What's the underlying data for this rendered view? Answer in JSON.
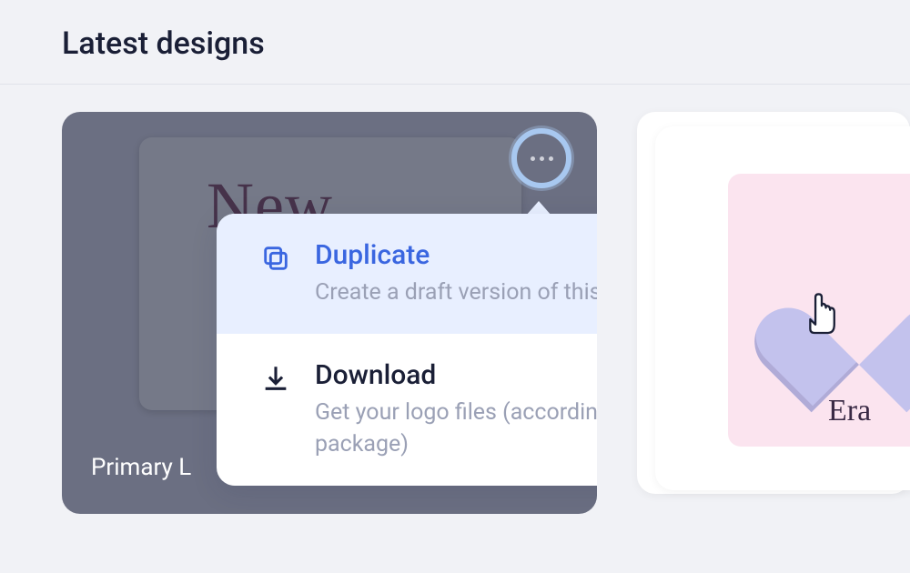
{
  "section": {
    "title": "Latest designs"
  },
  "cards": {
    "primary": {
      "preview_text": "New",
      "footer_label": "Primary L"
    },
    "secondary": {
      "preview_text": "Era"
    }
  },
  "menu": {
    "items": [
      {
        "title": "Duplicate",
        "desc": "Create a draft version of this logo"
      },
      {
        "title": "Download",
        "desc": "Get your logo files (according to your purchased package)"
      }
    ]
  }
}
